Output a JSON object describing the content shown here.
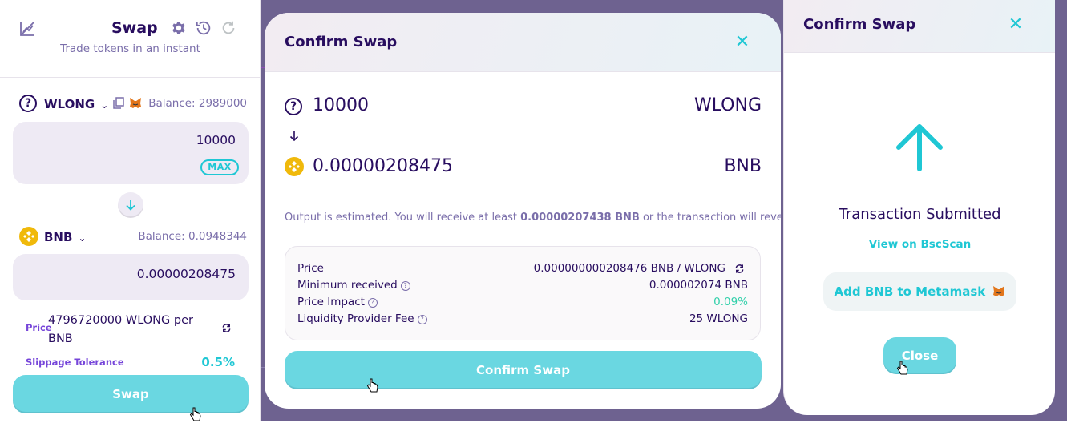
{
  "swap_panel": {
    "title": "Swap",
    "subtitle": "Trade tokens in an instant",
    "from": {
      "symbol": "WLONG",
      "balance": "Balance: 2989000",
      "amount": "10000",
      "max_label": "MAX"
    },
    "to": {
      "symbol": "BNB",
      "balance": "Balance: 0.0948344",
      "amount": "0.00000208475"
    },
    "price_label": "Price",
    "price_value": "4796720000 WLONG per BNB",
    "slippage_label": "Slippage Tolerance",
    "slippage_value": "0.5%",
    "swap_button": "Swap"
  },
  "confirm_modal": {
    "title": "Confirm Swap",
    "input_amount": "10000",
    "input_symbol": "WLONG",
    "output_amount": "0.00000208475",
    "output_symbol": "BNB",
    "note_prefix": "Output is estimated. You will receive at least ",
    "note_min": "0.00000207438 BNB",
    "note_suffix": " or the transaction will revert.",
    "details": [
      {
        "label": "Price",
        "value": "0.000000000208476 BNB / WLONG"
      },
      {
        "label": "Minimum received",
        "value": "0.000002074 BNB"
      },
      {
        "label": "Price Impact",
        "value": "0.09%"
      },
      {
        "label": "Liquidity Provider Fee",
        "value": "25 WLONG"
      }
    ],
    "confirm_button": "Confirm Swap"
  },
  "submitted_modal": {
    "title": "Confirm Swap",
    "status": "Transaction Submitted",
    "view_link": "View on BscScan",
    "add_token_button": "Add BNB to Metamask",
    "close_button": "Close"
  },
  "colors": {
    "primary_text": "#280d5f",
    "secondary_text": "#7a6eaa",
    "accent_teal": "#1fc7d4",
    "success": "#31d0aa",
    "overlay": "#6e6290",
    "bnb_yellow": "#f0b90b"
  }
}
